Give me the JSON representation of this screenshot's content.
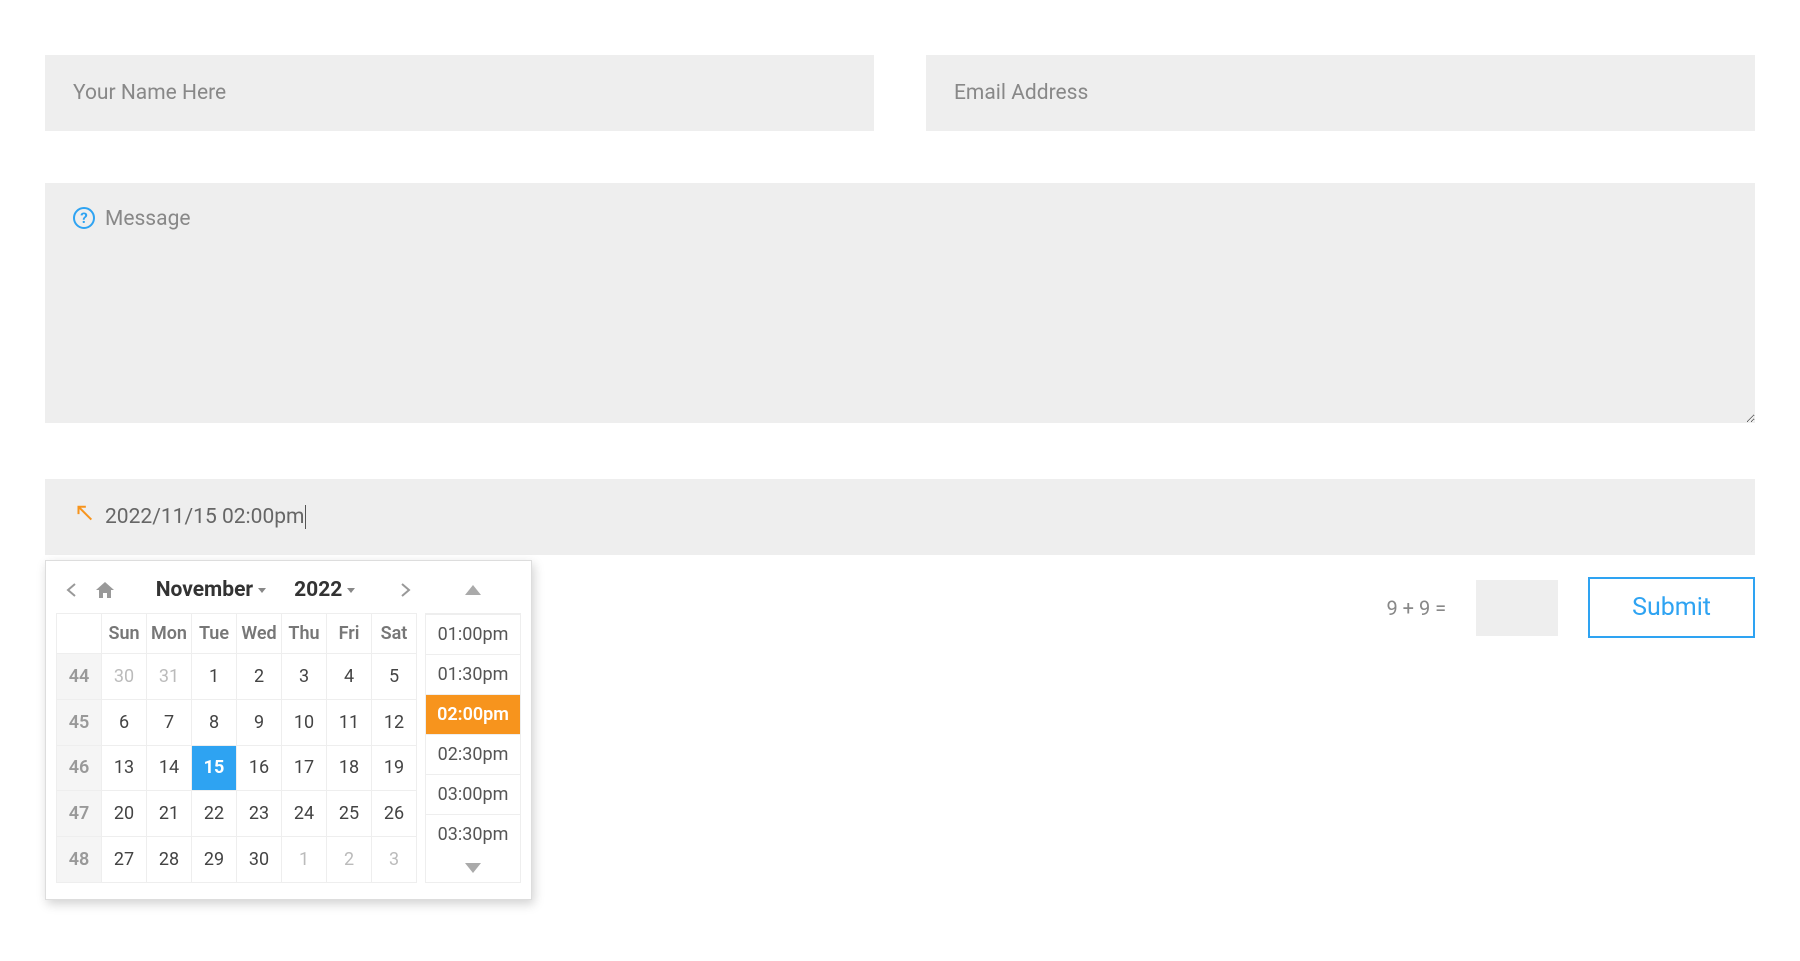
{
  "form": {
    "name_placeholder": "Your Name Here",
    "email_placeholder": "Email Address",
    "message_placeholder": "Message",
    "datetime_value": "2022/11/15 02:00pm",
    "captcha_label": "9 + 9 =",
    "submit_label": "Submit"
  },
  "picker": {
    "month_label": "November",
    "year_label": "2022",
    "weekdays": [
      "Sun",
      "Mon",
      "Tue",
      "Wed",
      "Thu",
      "Fri",
      "Sat"
    ],
    "weeks": [
      {
        "wk": "44",
        "days": [
          {
            "d": "30",
            "other": true
          },
          {
            "d": "31",
            "other": true
          },
          {
            "d": "1"
          },
          {
            "d": "2"
          },
          {
            "d": "3"
          },
          {
            "d": "4"
          },
          {
            "d": "5"
          }
        ]
      },
      {
        "wk": "45",
        "days": [
          {
            "d": "6"
          },
          {
            "d": "7"
          },
          {
            "d": "8"
          },
          {
            "d": "9"
          },
          {
            "d": "10"
          },
          {
            "d": "11"
          },
          {
            "d": "12"
          }
        ]
      },
      {
        "wk": "46",
        "days": [
          {
            "d": "13"
          },
          {
            "d": "14"
          },
          {
            "d": "15",
            "selected": true
          },
          {
            "d": "16"
          },
          {
            "d": "17"
          },
          {
            "d": "18"
          },
          {
            "d": "19"
          }
        ]
      },
      {
        "wk": "47",
        "days": [
          {
            "d": "20"
          },
          {
            "d": "21"
          },
          {
            "d": "22"
          },
          {
            "d": "23"
          },
          {
            "d": "24"
          },
          {
            "d": "25"
          },
          {
            "d": "26"
          }
        ]
      },
      {
        "wk": "48",
        "days": [
          {
            "d": "27"
          },
          {
            "d": "28"
          },
          {
            "d": "29"
          },
          {
            "d": "30"
          },
          {
            "d": "1",
            "other": true
          },
          {
            "d": "2",
            "other": true
          },
          {
            "d": "3",
            "other": true
          }
        ]
      }
    ],
    "times": [
      {
        "t": "01:00pm"
      },
      {
        "t": "01:30pm"
      },
      {
        "t": "02:00pm",
        "selected": true
      },
      {
        "t": "02:30pm"
      },
      {
        "t": "03:00pm"
      },
      {
        "t": "03:30pm"
      }
    ]
  }
}
